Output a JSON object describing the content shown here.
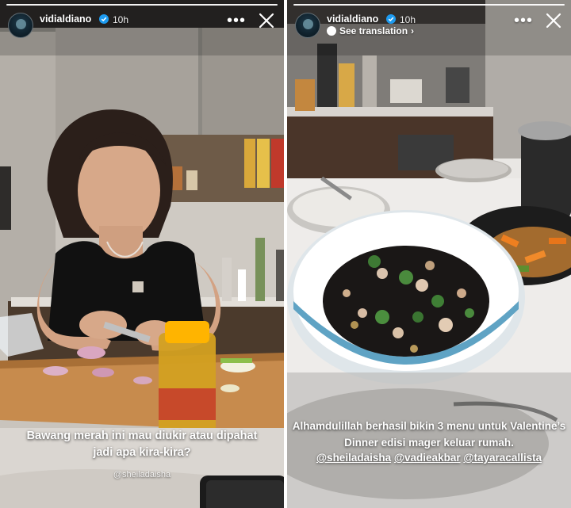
{
  "left_story": {
    "username": "vidialdiano",
    "time": "10h",
    "more_label": "•••",
    "caption": "Bawang merah ini mau diukir atau dipahat jadi apa kira-kira?",
    "tag": "@sheiladaisha"
  },
  "right_story": {
    "username": "vidialdiano",
    "time": "10h",
    "translation_label": "See translation",
    "more_label": "•••",
    "caption": "Alhamdulillah berhasil bikin 3 menu untuk Valentine’s Dinner edisi mager keluar rumah.",
    "mentions": [
      "@sheiladaisha",
      "@vadieakbar",
      "@tayaracallista"
    ]
  },
  "colors": {
    "verified_badge": "#1d9bf0",
    "header_text": "#ffffff"
  },
  "icons": [
    "verified-badge-icon",
    "more-options-icon",
    "close-icon",
    "translate-icon"
  ]
}
